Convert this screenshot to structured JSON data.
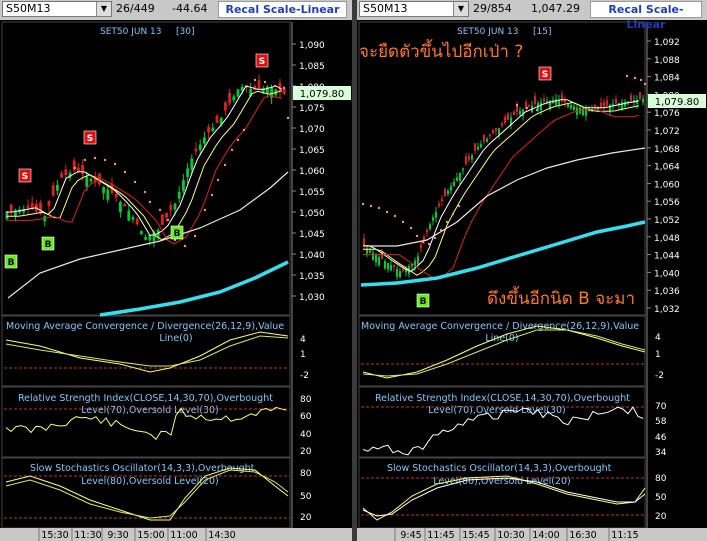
{
  "colors": {
    "up": "#00cc33",
    "down": "#e02020",
    "ma_fast": "#ffffff",
    "ma_mid": "#ffff66",
    "ma_slow": "#dd2222",
    "ma_long": "#e8e8e8",
    "ma_cyan": "#33e0f0",
    "dots": "#ff8a8a",
    "signal_s": "#e01010",
    "signal_b": "#66ee22",
    "accent": "#1d3fbf",
    "annotation": "#ff7722"
  },
  "left": {
    "symbol": "S50M13",
    "count": "26/449",
    "change": "-44.64",
    "recal": "Recal Scale-Linear",
    "title": "SET50 JUN 13",
    "interval": "[30]",
    "price_ticks": [
      "1,090",
      "1,085",
      "1,080",
      "1,075",
      "1,070",
      "1,065",
      "1,060",
      "1,055",
      "1,050",
      "1,045",
      "1,040",
      "1,035",
      "1,030"
    ],
    "last_price": "1,079.80",
    "macd_title": "Moving Average Convergence / Divergence(26,12,9),Value",
    "macd_title2": "Line(0)",
    "macd_ticks": [
      "4",
      "1",
      "-2"
    ],
    "rsi_title": "Relative Strength Index(CLOSE,14,30,70),Overbought",
    "rsi_title2": "Level(70),Oversold Level(30)",
    "rsi_ticks": [
      "80",
      "60",
      "40",
      "20"
    ],
    "sto_title": "Slow Stochastics Oscillator(14,3,3),Overbought",
    "sto_title2": "Level(80),Oversold Level(20)",
    "sto_ticks": [
      "80",
      "50",
      "20"
    ],
    "time_ticks": [
      "15:30",
      "11:30",
      "9:30",
      "15:00",
      "11:00",
      "14:30"
    ],
    "signals": [
      {
        "t": "S"
      },
      {
        "t": "S"
      },
      {
        "t": "S"
      },
      {
        "t": "B"
      },
      {
        "t": "B"
      },
      {
        "t": "B"
      }
    ]
  },
  "right": {
    "symbol": "S50M13",
    "count": "29/854",
    "change": "1,047.29",
    "recal": "Recal Scale-Linear",
    "title": "SET50 JUN 13",
    "interval": "[15]",
    "price_ticks": [
      "1,092",
      "1,088",
      "1,084",
      "1,080",
      "1,076",
      "1,072",
      "1,068",
      "1,064",
      "1,060",
      "1,056",
      "1,052",
      "1,048",
      "1,044",
      "1,040",
      "1,036",
      "1,032"
    ],
    "last_price": "1,079.80",
    "macd_title": "Moving Average Convergence / Divergence(26,12,9),Value",
    "macd_title2": "Line(0)",
    "macd_ticks": [
      "4",
      "1",
      "-2"
    ],
    "rsi_title": "Relative Strength Index(CLOSE,14,30,70),Overbought",
    "rsi_title2": "Level(70),Oversold Level(30)",
    "rsi_ticks": [
      "70",
      "58",
      "46",
      "34"
    ],
    "sto_title": "Slow Stochastics Oscillator(14,3,3),Overbought",
    "sto_title2": "Level(80),Oversold Level(20)",
    "sto_ticks": [
      "80",
      "50",
      "20"
    ],
    "time_ticks": [
      "9:45",
      "11:45",
      "15:45",
      "10:30",
      "14:00",
      "16:30",
      "11:15"
    ],
    "annotation_top": "จะยืดตัวขึ้นไปอีกเป่า ?",
    "annotation_bottom": "ดึงขึ้นอีกนิด B จะมา",
    "signals": [
      {
        "t": "S"
      },
      {
        "t": "B"
      }
    ]
  }
}
